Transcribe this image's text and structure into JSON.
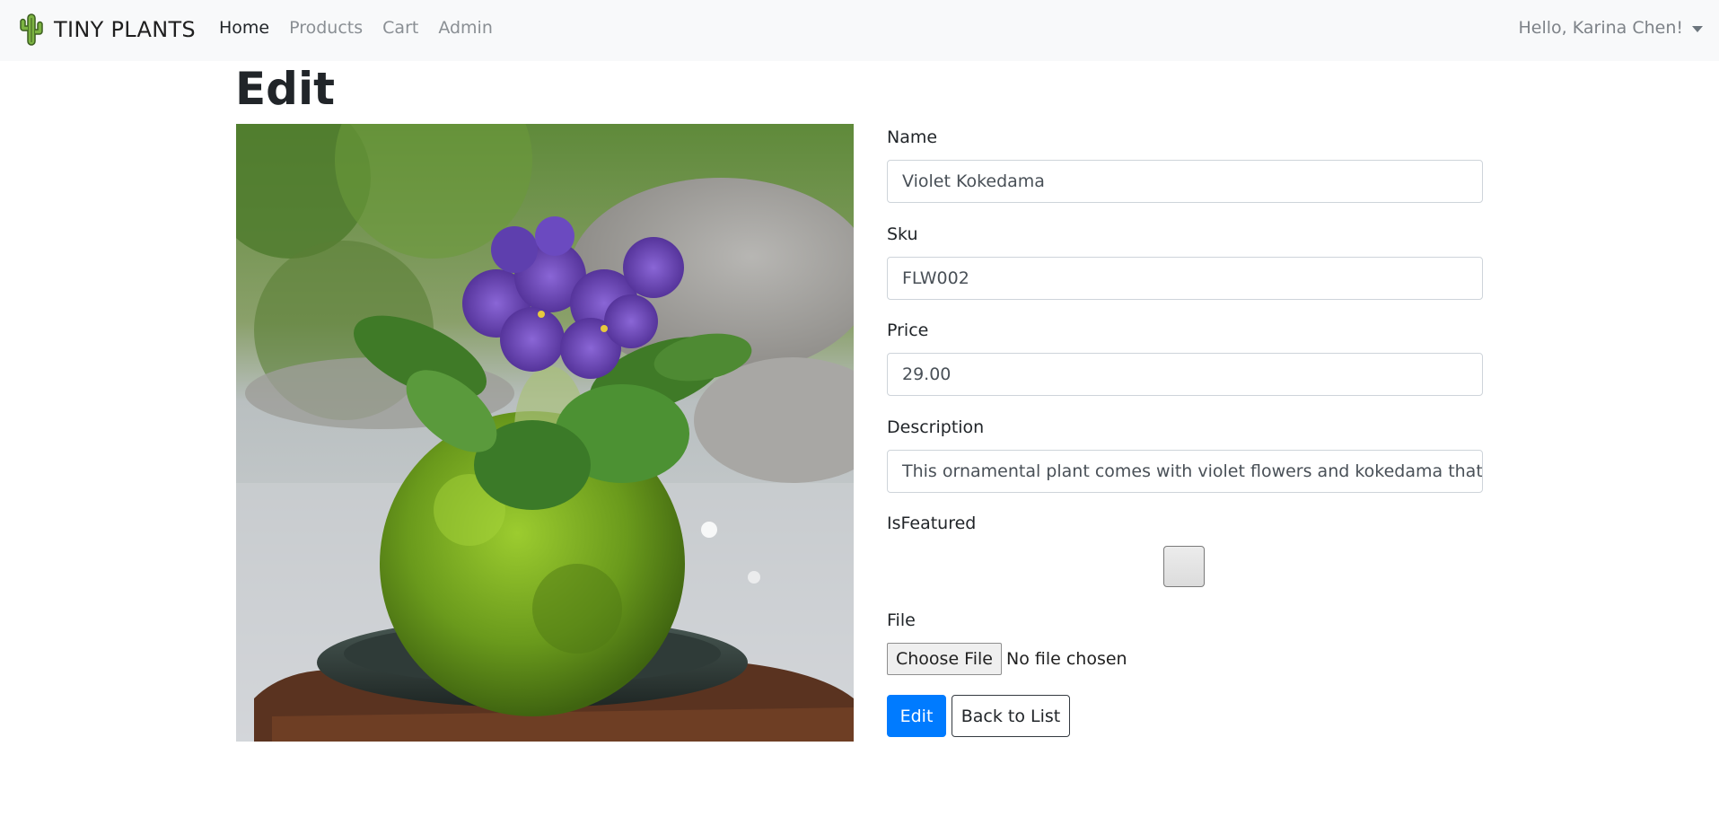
{
  "navbar": {
    "brand": "TINY PLANTS",
    "brand_icon": "cactus-icon",
    "links": [
      {
        "label": "Home",
        "active": true
      },
      {
        "label": "Products",
        "active": false
      },
      {
        "label": "Cart",
        "active": false
      },
      {
        "label": "Admin",
        "active": false
      }
    ],
    "user_greeting": "Hello, Karina Chen!"
  },
  "page": {
    "title": "Edit"
  },
  "product_image": {
    "subject": "purple violet flowers on a moss kokedama ball in a dark dish"
  },
  "form": {
    "name_label": "Name",
    "name_value": "Violet Kokedama",
    "sku_label": "Sku",
    "sku_value": "FLW002",
    "price_label": "Price",
    "price_value": "29.00",
    "description_label": "Description",
    "description_value": "This ornamental plant comes with violet flowers and kokedama that adc",
    "featured_label": "IsFeatured",
    "featured_checked": false,
    "file_label": "File",
    "file_button": "Choose File",
    "file_status": "No file chosen",
    "submit_label": "Edit",
    "back_label": "Back to List"
  },
  "colors": {
    "primary": "#007bff",
    "navbar_bg": "#f8f9fa",
    "text": "#212529",
    "muted_link": "#8a8f94"
  }
}
